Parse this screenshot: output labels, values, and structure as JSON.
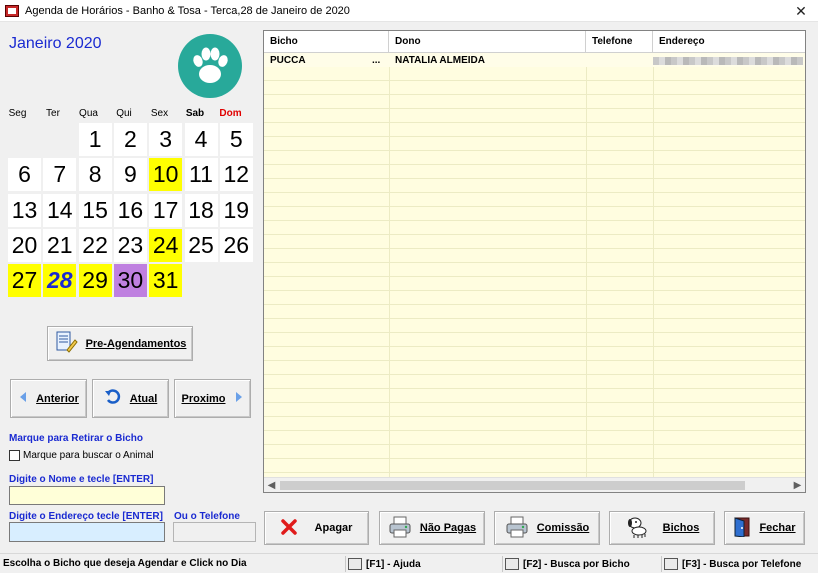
{
  "window": {
    "title": "Agenda de Horários - Banho & Tosa - Terca,28 de Janeiro de 2020",
    "close_glyph": "✕",
    "app_icon": "app-icon"
  },
  "calendar": {
    "month_label": "Janeiro 2020",
    "weekdays": [
      "Seg",
      "Ter",
      "Qua",
      "Qui",
      "Sex",
      "Sab",
      "Dom"
    ],
    "first_weekday_index": 2,
    "days_in_month": 31,
    "highlighted_days": [
      10,
      24,
      27,
      28,
      29,
      31
    ],
    "selected_day": 30,
    "today": 28,
    "colors": {
      "highlight": "#ffff00",
      "selected": "#bf80e0",
      "today_text": "#1a2ad1",
      "sunday": "#e00000"
    }
  },
  "buttons": {
    "pre_agendamentos": "Pre-Agendamentos",
    "anterior": "Anterior",
    "atual": "Atual",
    "proximo": "Proximo",
    "apagar": "Apagar",
    "nao_pagas": "Não Pagas",
    "comissao": "Comissão",
    "bichos": "Bichos",
    "fechar": "Fechar"
  },
  "form": {
    "retirar_label": "Marque para Retirar o Bicho",
    "buscar_animal_label": "Marque para buscar o Animal",
    "nome_label": "Digite o Nome e tecle [ENTER]",
    "nome_value": "",
    "endereco_label": "Digite o Endereço tecle [ENTER]",
    "endereco_value": "",
    "telefone_label": "Ou o Telefone",
    "telefone_value": ""
  },
  "grid": {
    "columns": [
      "Bicho",
      "Dono",
      "Telefone",
      "Endereço"
    ],
    "rows": [
      {
        "bicho": "PUCCA",
        "marker": "...",
        "dono": "NATALIA ALMEIDA",
        "telefone": "",
        "endereco": ""
      }
    ]
  },
  "status": {
    "hint": "Escolha o Bicho que deseja Agendar e Click no Dia",
    "f1": "[F1] - Ajuda",
    "f2": "[F2] - Busca por Bicho",
    "f3": "[F3] - Busca por Telefone"
  }
}
